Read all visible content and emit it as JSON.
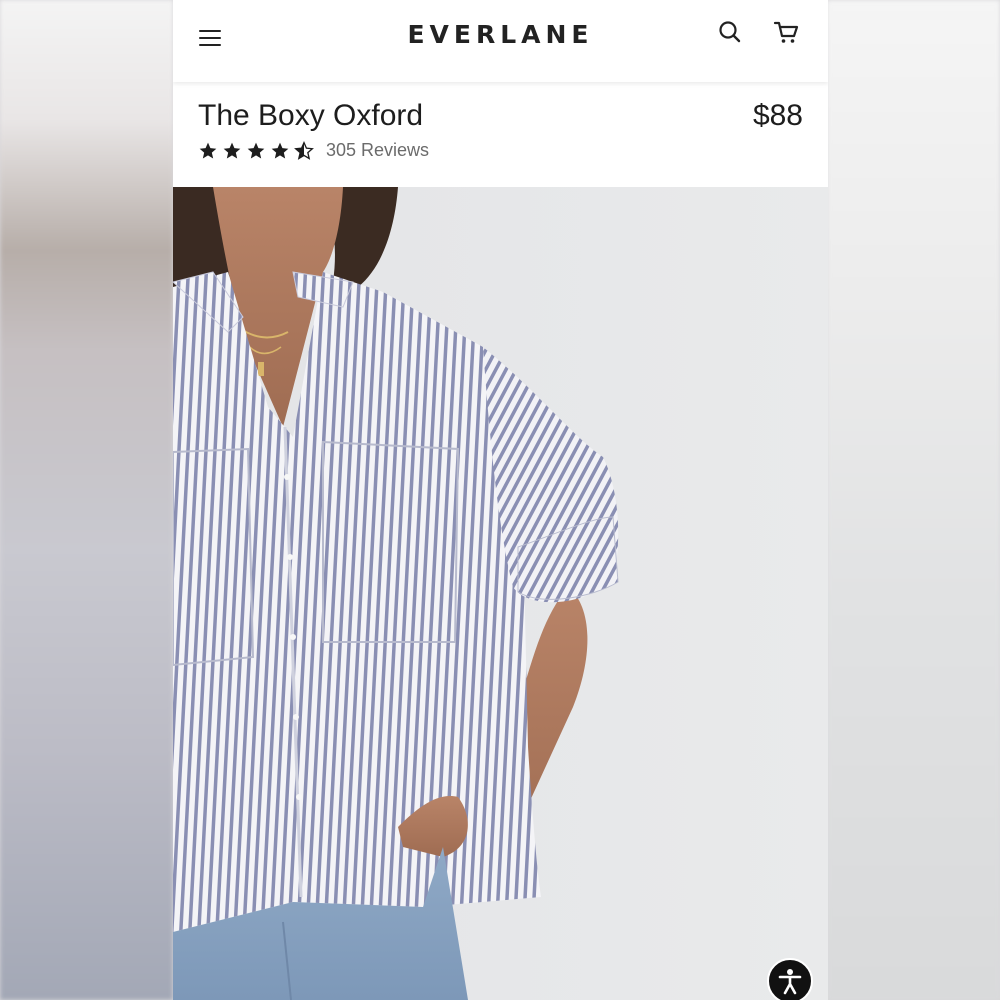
{
  "header": {
    "brand": "EVERLANE",
    "icons": {
      "menu": "hamburger-menu-icon",
      "search": "search-icon",
      "cart": "cart-icon"
    }
  },
  "product": {
    "title": "The Boxy Oxford",
    "price": "$88",
    "rating": 4.5,
    "rating_max": 5,
    "reviews_label": "305 Reviews"
  },
  "image": {
    "subject": "model wearing blue and white striped oversized oxford shirt with light jeans"
  },
  "colors": {
    "text": "#1d1d1d",
    "muted": "#6b6b6b",
    "shirt_stripe": "#8a8fb3",
    "background": "#e6e7e9"
  }
}
